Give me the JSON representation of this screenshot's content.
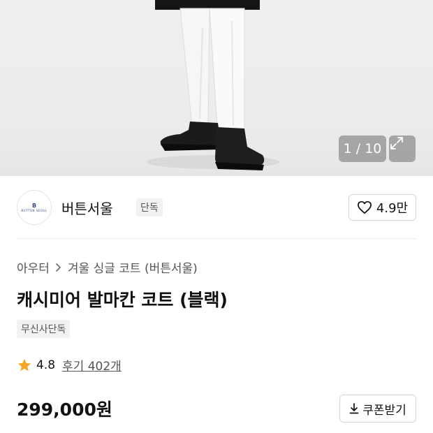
{
  "gallery": {
    "counter": "1 / 10",
    "expand_icon": "expand-icon"
  },
  "brand": {
    "logo_mark": "B",
    "logo_text": "BUTTON SEOUL",
    "name": "버튼서울",
    "tag": "단독"
  },
  "like": {
    "count": "4.9만",
    "icon": "heart-icon"
  },
  "breadcrumb": {
    "category": "아우터",
    "subcategory": "겨울 싱글 코트 (버튼서울)"
  },
  "product": {
    "title": "캐시미어 발마칸 코트 (블랙)",
    "badge": "무신사단독",
    "rating": "4.8",
    "reviews": "후기 402개",
    "price": "299,000원"
  },
  "coupon": {
    "label": "쿠폰받기",
    "icon": "download-icon"
  },
  "colors": {
    "star": "#f5a623",
    "text": "#111111",
    "muted": "#555555",
    "border": "#d6d6d6"
  }
}
